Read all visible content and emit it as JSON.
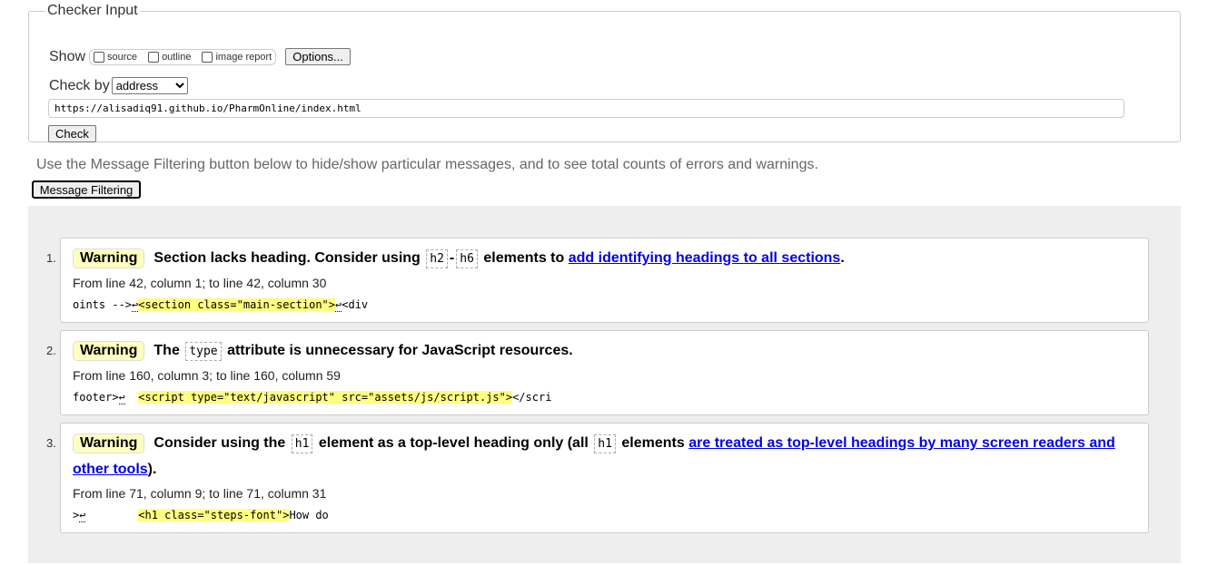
{
  "checker": {
    "legend": "Checker Input",
    "show_label": "Show",
    "show_options": [
      "source",
      "outline",
      "image report"
    ],
    "options_button": "Options...",
    "checkby_label": "Check by",
    "checkby_value": "address",
    "url": "https://alisadiq91.github.io/PharmOnline/index.html",
    "check_button": "Check"
  },
  "info_text": "Use the Message Filtering button below to hide/show particular messages, and to see total counts of errors and warnings.",
  "filter_button": "Message Filtering",
  "messages": [
    {
      "num": "1.",
      "type": "Warning",
      "t1": "Section lacks heading. Consider using",
      "c1": "h2",
      "sep": "-",
      "c2": "h6",
      "t2": "elements to",
      "link": "add identifying headings to all sections",
      "t3": ".",
      "location": "From line 42, column 1; to line 42, column 30",
      "pre": "oints -->",
      "ret": "↩",
      "hl": "<section class=\"main-section\">",
      "ret2": "↩",
      "post": "<div"
    },
    {
      "num": "2.",
      "type": "Warning",
      "t1": "The",
      "c1": "type",
      "t2": "attribute is unnecessary for JavaScript resources.",
      "location": "From line 160, column 3; to line 160, column 59",
      "pre": "footer>",
      "ret": "↩",
      "gap": "  ",
      "hl": "<script type=\"text/javascript\" src=\"assets/js/script.js\">",
      "post": "</scri"
    },
    {
      "num": "3.",
      "type": "Warning",
      "t1": "Consider using the",
      "c1": "h1",
      "t2": "element as a top-level heading only (all",
      "c2": "h1",
      "t3": "elements",
      "link": "are treated as top-level headings by many screen readers and other tools",
      "t4": ").",
      "location": "From line 71, column 9; to line 71, column 31",
      "pre": ">",
      "ret": "↩",
      "gap": "        ",
      "hl": "<h1 class=\"steps-font\">",
      "post": "How do"
    }
  ]
}
